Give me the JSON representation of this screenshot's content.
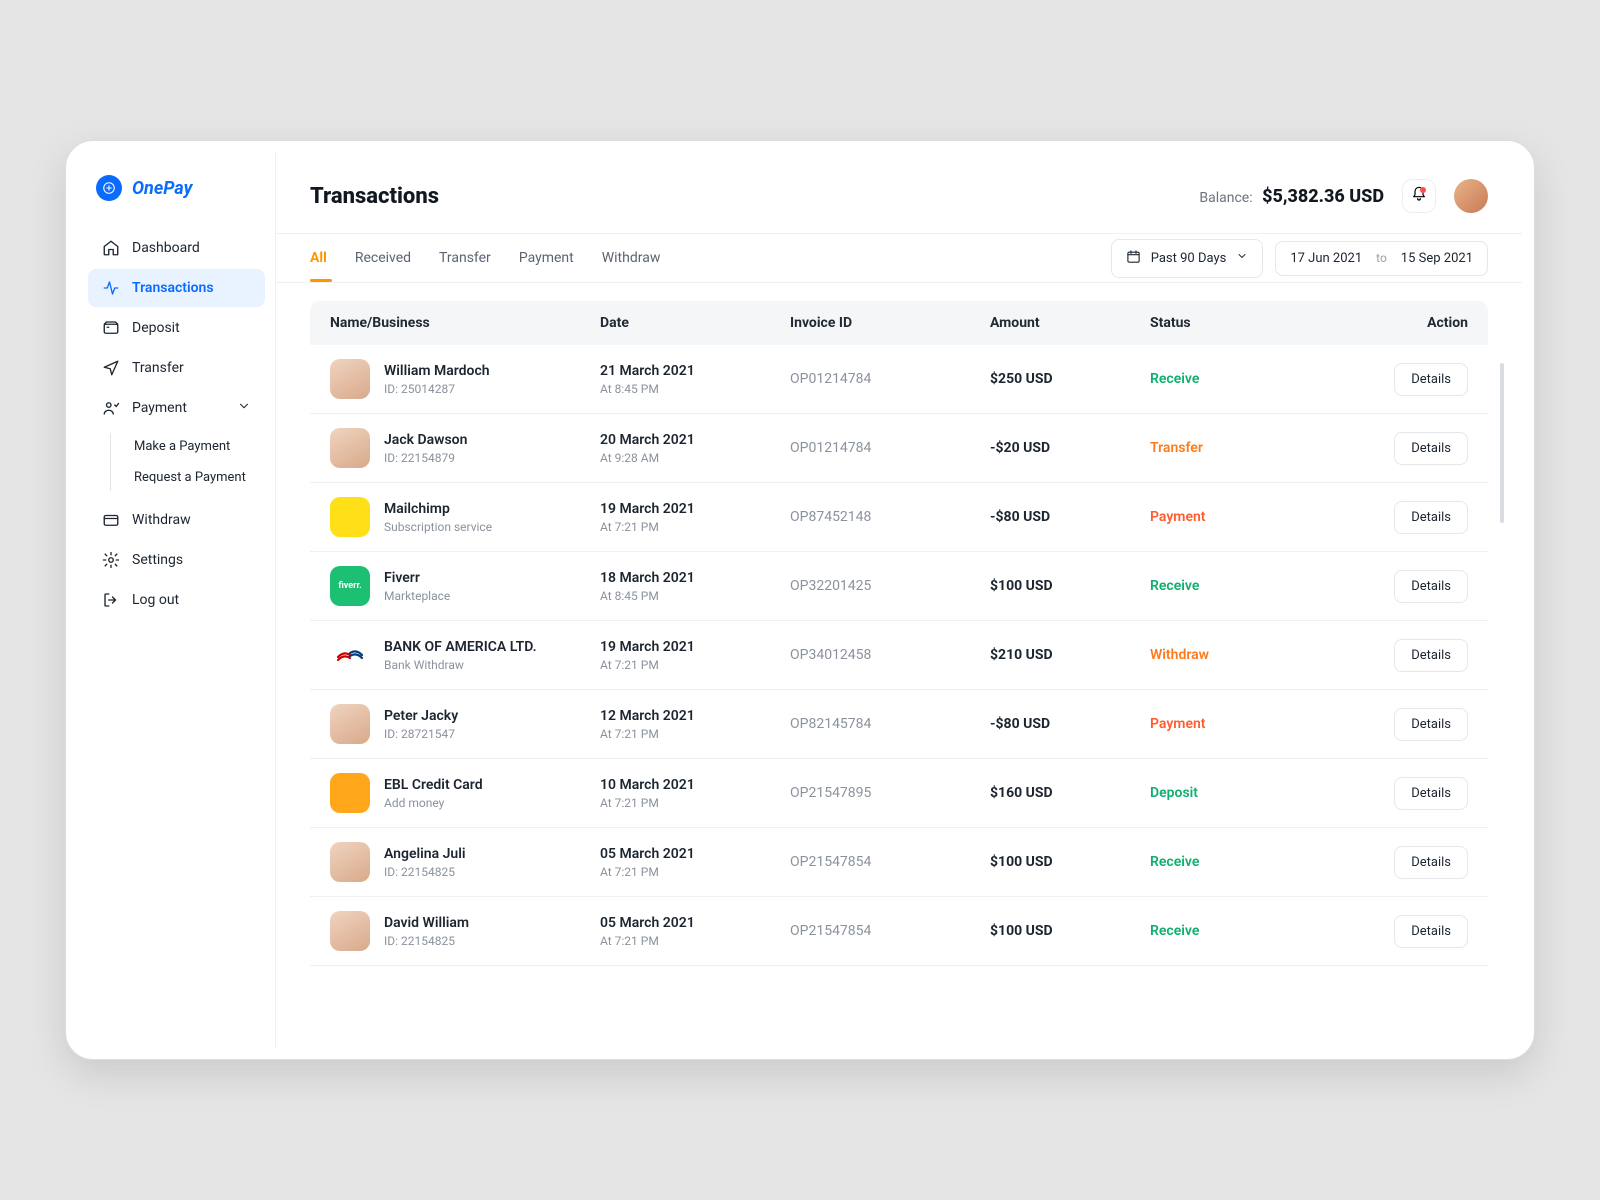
{
  "brand": {
    "name": "OnePay"
  },
  "sidebar": {
    "items": [
      {
        "label": "Dashboard"
      },
      {
        "label": "Transactions"
      },
      {
        "label": "Deposit"
      },
      {
        "label": "Transfer"
      },
      {
        "label": "Payment",
        "sub": [
          {
            "label": "Make a Payment"
          },
          {
            "label": "Request a Payment"
          }
        ]
      },
      {
        "label": "Withdraw"
      },
      {
        "label": "Settings"
      },
      {
        "label": "Log out"
      }
    ]
  },
  "header": {
    "title": "Transactions",
    "balance_label": "Balance:",
    "balance_value": "$5,382.36 USD"
  },
  "filters": {
    "tabs": [
      "All",
      "Received",
      "Transfer",
      "Payment",
      "Withdraw"
    ],
    "range_preset": "Past 90 Days",
    "date_from": "17 Jun 2021",
    "date_to_sep": "to",
    "date_to": "15 Sep 2021"
  },
  "table": {
    "headers": {
      "name": "Name/Business",
      "date": "Date",
      "invoice": "Invoice ID",
      "amount": "Amount",
      "status": "Status",
      "action": "Action"
    },
    "action_label": "Details",
    "rows": [
      {
        "name": "William Mardoch",
        "sub": "ID: 25014287",
        "date": "21 March 2021",
        "time": "At 8:45 PM",
        "invoice": "OP01214784",
        "amount": "$250 USD",
        "status": "Receive",
        "avatar": "person"
      },
      {
        "name": "Jack Dawson",
        "sub": "ID: 22154879",
        "date": "20 March 2021",
        "time": "At 9:28 AM",
        "invoice": "OP01214784",
        "amount": "-$20 USD",
        "status": "Transfer",
        "avatar": "person"
      },
      {
        "name": "Mailchimp",
        "sub": "Subscription service",
        "date": "19 March 2021",
        "time": "At 7:21 PM",
        "invoice": "OP87452148",
        "amount": "-$80 USD",
        "status": "Payment",
        "avatar_bg": "#ffe018"
      },
      {
        "name": "Fiverr",
        "sub": "Markteplace",
        "date": "18 March 2021",
        "time": "At 8:45 PM",
        "invoice": "OP32201425",
        "amount": "$100 USD",
        "status": "Receive",
        "avatar_bg": "#1dbf73",
        "avatar_text": "fiverr."
      },
      {
        "name": "BANK OF AMERICA LTD.",
        "sub": "Bank Withdraw",
        "date": "19 March 2021",
        "time": "At 7:21 PM",
        "invoice": "OP34012458",
        "amount": "$210 USD",
        "status": "Withdraw",
        "avatar_bg": "#ffffff",
        "avatar_logo": "boa"
      },
      {
        "name": "Peter Jacky",
        "sub": "ID: 28721547",
        "date": "12 March 2021",
        "time": "At 7:21 PM",
        "invoice": "OP82145784",
        "amount": "-$80 USD",
        "status": "Payment",
        "avatar": "person"
      },
      {
        "name": "EBL Credit Card",
        "sub": "Add money",
        "date": "10 March 2021",
        "time": "At 7:21 PM",
        "invoice": "OP21547895",
        "amount": "$160 USD",
        "status": "Deposit",
        "avatar_bg": "#ffa61a"
      },
      {
        "name": "Angelina Juli",
        "sub": "ID: 22154825",
        "date": "05 March 2021",
        "time": "At 7:21 PM",
        "invoice": "OP21547854",
        "amount": "$100 USD",
        "status": "Receive",
        "avatar": "person"
      },
      {
        "name": "David William",
        "sub": "ID: 22154825",
        "date": "05 March 2021",
        "time": "At 7:21 PM",
        "invoice": "OP21547854",
        "amount": "$100 USD",
        "status": "Receive",
        "avatar": "person"
      }
    ]
  }
}
